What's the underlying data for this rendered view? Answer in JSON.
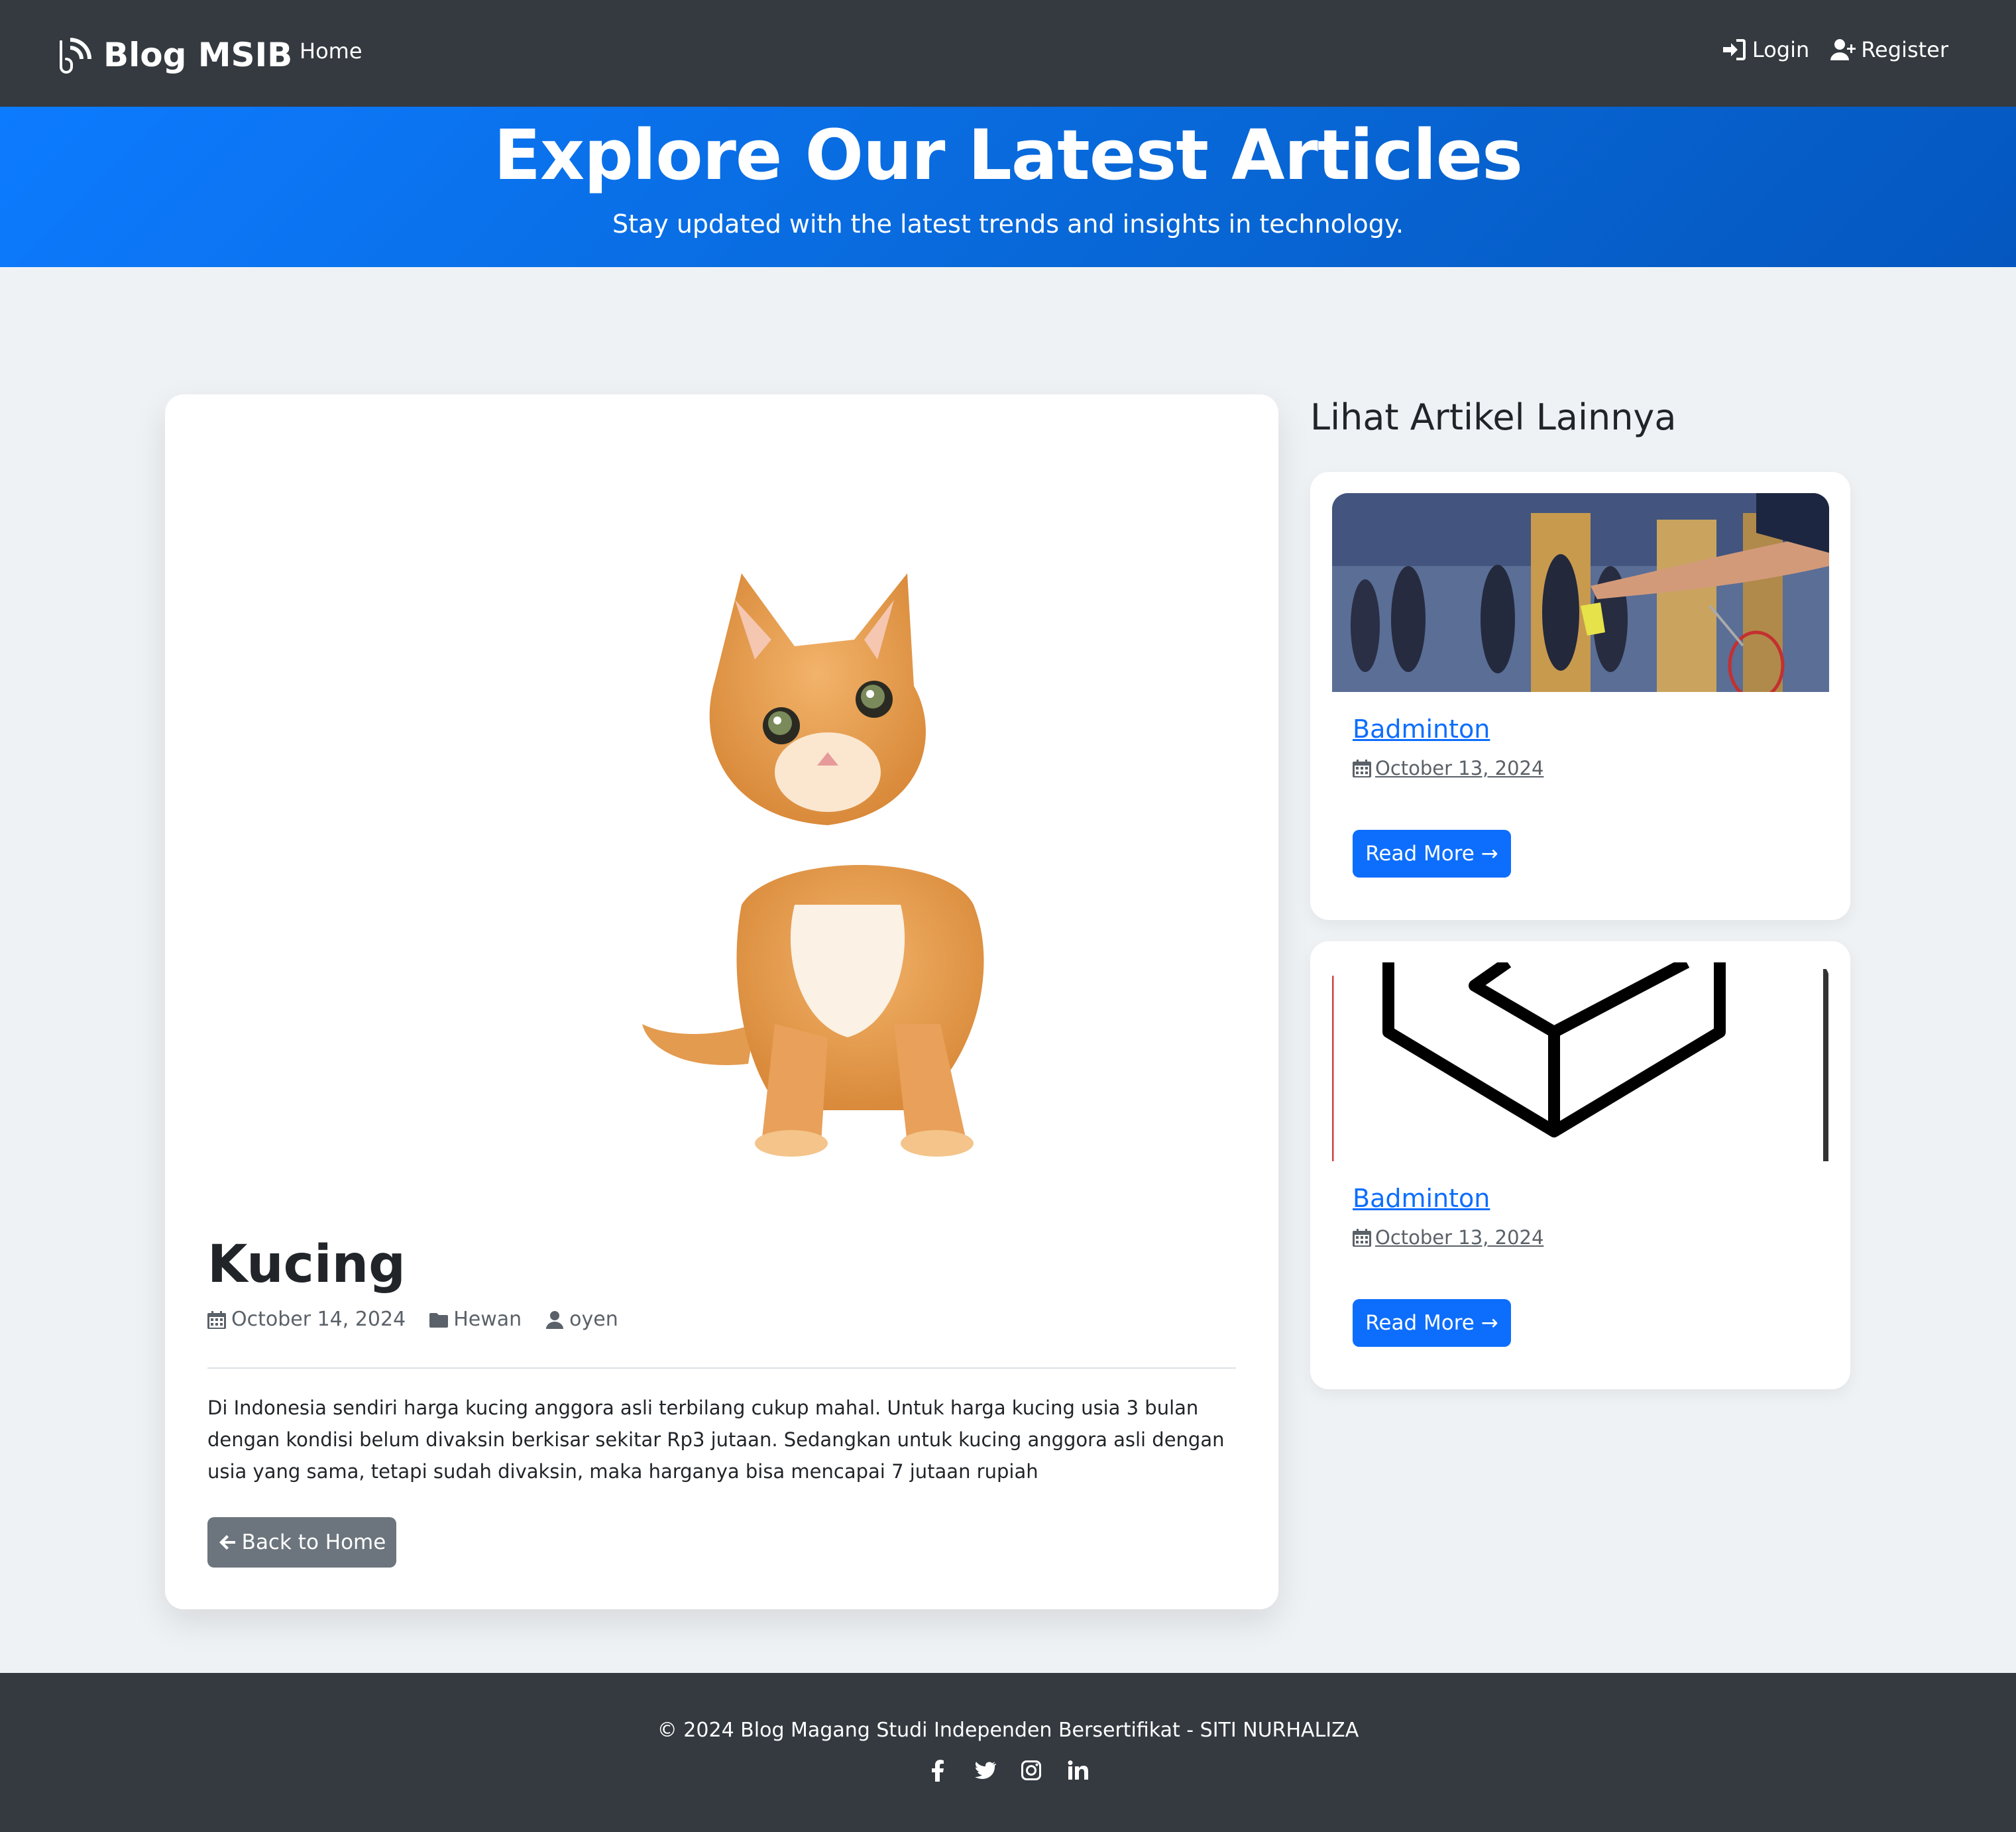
{
  "navbar": {
    "brand": "Blog MSIB",
    "home": "Home",
    "login": "Login",
    "register": "Register"
  },
  "hero": {
    "title": "Explore Our Latest Articles",
    "subtitle": "Stay updated with the latest trends and insights in technology."
  },
  "article": {
    "title": "Kucing",
    "date": "October 14, 2024",
    "category": "Hewan",
    "author": "oyen",
    "body": "Di Indonesia sendiri harga kucing anggora asli terbilang cukup mahal. Untuk harga kucing usia 3 bulan dengan kondisi belum divaksin berkisar sekitar Rp3 jutaan. Sedangkan untuk kucing anggora asli dengan usia yang sama, tetapi sudah divaksin, maka harganya bisa mencapai 7 jutaan rupiah",
    "back_label": "Back to Home"
  },
  "sidebar": {
    "heading": "Lihat Artikel Lainnya",
    "cards": [
      {
        "title": "Badminton",
        "date": "October 13, 2024",
        "button": "Read More →"
      },
      {
        "title": "Badminton",
        "date": "October 13, 2024",
        "button": "Read More →"
      }
    ]
  },
  "footer": {
    "text": "© 2024 Blog Magang Studi Independen Bersertifikat - SITI NURHALIZA",
    "socials": [
      "facebook-icon",
      "twitter-icon",
      "instagram-icon",
      "linkedin-icon"
    ]
  },
  "colors": {
    "navbar": "#343a40",
    "hero": "#0d6efd",
    "primary_button": "#0d6efd",
    "secondary_button": "#6c757d",
    "page_bg": "#eff2f5"
  }
}
